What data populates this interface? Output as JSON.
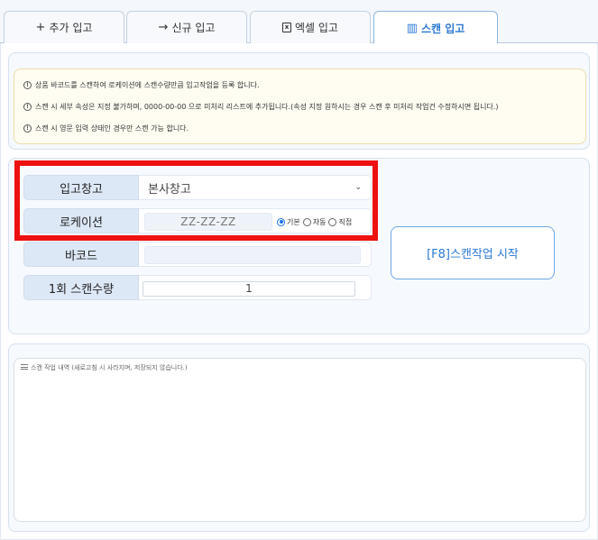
{
  "tabs": [
    {
      "label": "추가 입고",
      "icon": "plus-icon",
      "glyph": "+"
    },
    {
      "label": "신규 입고",
      "icon": "arrow-right-icon",
      "glyph": "→"
    },
    {
      "label": "엑셀 입고",
      "icon": "excel-file-icon",
      "glyph": "x"
    },
    {
      "label": "스캔 입고",
      "icon": "barcode-icon",
      "glyph": "▥",
      "active": true
    }
  ],
  "notices": [
    "상품 바코드를 스캔하여 로케이션에 스캔수량만큼 입고작업을 등록 합니다.",
    "스캔 시 세부 속성은 지정 불가하며, 0000-00-00 으로 미처리 리스트에 추가됩니다.(속성 지정 원하시는 경우 스캔 후 미처리 작업건 수정하시면 됩니다.)",
    "스캔 시 영문 입력 상태인 경우만 스캔 가능 합니다."
  ],
  "form": {
    "warehouse": {
      "label": "입고창고",
      "value": "본사창고"
    },
    "location": {
      "label": "로케이션",
      "placeholder": "ZZ-ZZ-ZZ",
      "options": [
        "기본",
        "자동",
        "직접"
      ],
      "selected": "기본"
    },
    "barcode": {
      "label": "바코드",
      "value": ""
    },
    "scan_qty": {
      "label": "1회 스캔수량",
      "value": "1"
    }
  },
  "scan_button": {
    "label": "[F8]스캔작업 시작"
  },
  "log": {
    "placeholder": "스캔 작업 내역 (새로고침 시 사라지며, 저장되지 않습니다.)"
  },
  "colors": {
    "accent": "#2b78d4",
    "highlight": "#ee1111",
    "label_bg": "#dde8f6",
    "notice_bg": "#fffdf2"
  }
}
